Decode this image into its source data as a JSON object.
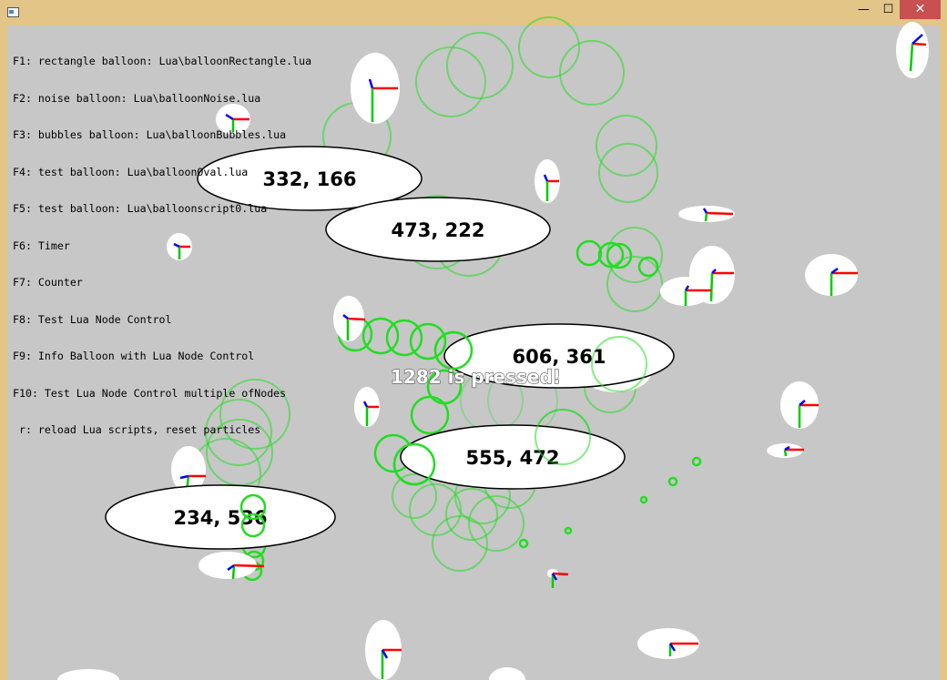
{
  "window": {
    "minimize_glyph": "—",
    "maximize_glyph": "☐",
    "close_glyph": "✕"
  },
  "help_lines": [
    "F1: rectangle balloon: Lua\\balloonRectangle.lua",
    "F2: noise balloon: Lua\\balloonNoise.lua",
    "F3: bubbles balloon: Lua\\balloonBubbles.lua",
    "F4: test balloon: Lua\\balloonOval.lua",
    "F5: test balloon: Lua\\balloonscript0.lua",
    "F6: Timer",
    "F7: Counter",
    "F8: Test Lua Node Control",
    "F9: Info Balloon with Lua Node Control",
    "F10: Test Lua Node Control multiple ofNodes",
    " r: reload Lua scripts, reset particles"
  ],
  "balloons": [
    {
      "label": "332, 166"
    },
    {
      "label": "473, 222"
    },
    {
      "label": "606, 361"
    },
    {
      "label": "555, 472"
    },
    {
      "label": "234, 536"
    }
  ],
  "pressed_message": "1282 is pressed!",
  "colors": {
    "background": "#c7c7c7",
    "frame": "#e2c587",
    "close": "#c75050",
    "bubble": "#22dd22",
    "axis_x": "#ff0000",
    "axis_y": "#00cc00",
    "axis_z": "#0000ff"
  }
}
